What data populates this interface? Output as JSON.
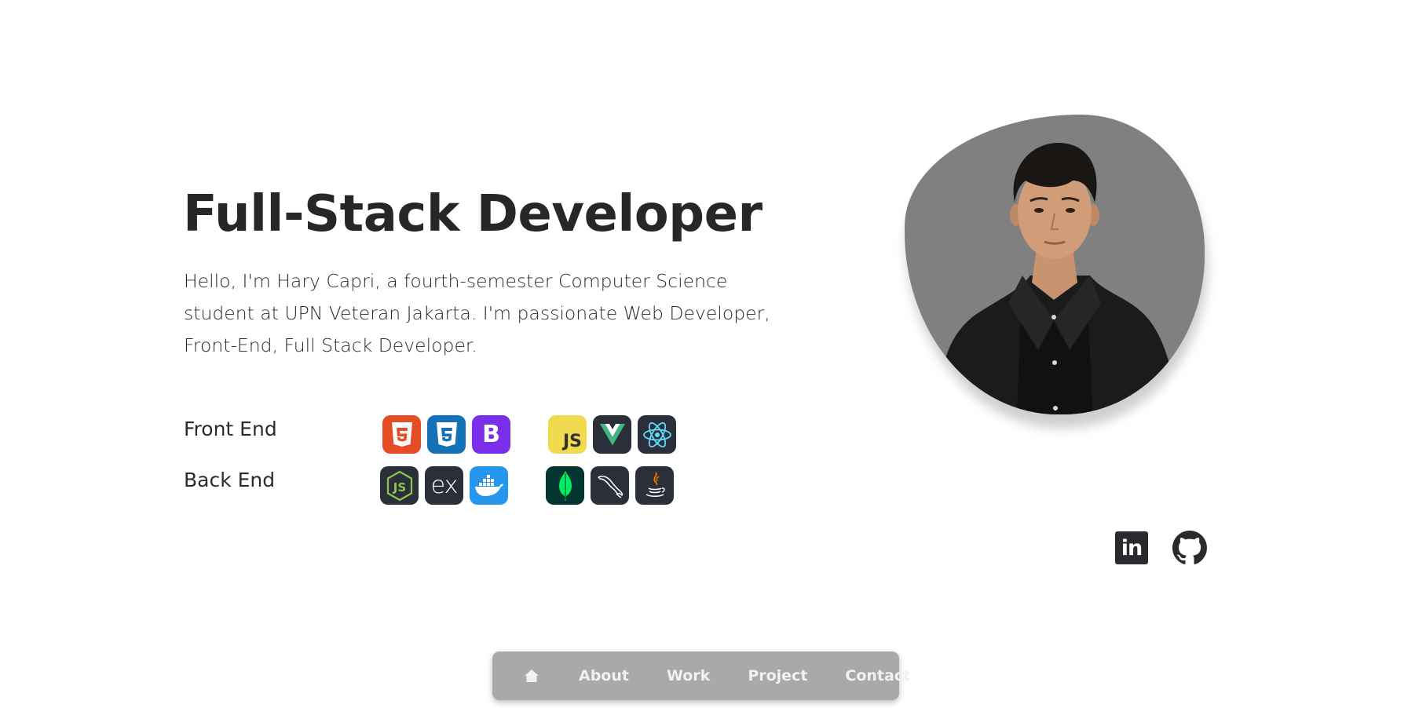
{
  "hero": {
    "title": "Full-Stack Developer",
    "intro": "Hello, I'm Hary Capri, a fourth-semester Computer Science student at UPN Veteran Jakarta. I'm passionate Web Developer, Front-End, Full Stack Developer."
  },
  "stack": {
    "front_end": {
      "label": "Front End",
      "icons": [
        "html5-icon",
        "css3-icon",
        "bootstrap-icon",
        "javascript-icon",
        "vue-icon",
        "react-icon"
      ],
      "icon_text": {
        "bootstrap": "B",
        "javascript": "JS"
      }
    },
    "back_end": {
      "label": "Back End",
      "icons": [
        "nodejs-icon",
        "express-icon",
        "docker-icon",
        "mongodb-icon",
        "mysql-icon",
        "java-icon"
      ],
      "icon_text": {
        "nodejs": "JS",
        "express": "ex"
      }
    }
  },
  "profile": {
    "photo": "profile-photo"
  },
  "social": {
    "linkedin_text": "in",
    "icons": [
      "linkedin-icon",
      "github-icon"
    ]
  },
  "nav": {
    "home_icon": "home-icon",
    "about": "About",
    "work": "Work",
    "project": "Project",
    "contact": "Contact"
  },
  "colors": {
    "text": "#2b2b2f",
    "photo_bg": "#808080",
    "navbar_bg": "#a9a9a9",
    "nav_text": "#f1f1f1",
    "html5": "#e44d26",
    "css3": "#1572b6",
    "bootstrap": "#7952b3",
    "javascript": "#f0db4f",
    "dark_tile": "#2b2f3a",
    "docker": "#2496ed",
    "mongodb": "#023430"
  }
}
